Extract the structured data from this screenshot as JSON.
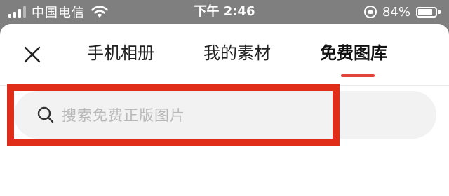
{
  "status_bar": {
    "carrier": "中国电信",
    "time": "下午 2:46",
    "battery_percent": "84%",
    "battery_level": 0.84,
    "icons": [
      "signal-icon",
      "wifi-icon",
      "rotation-lock-icon",
      "battery-icon"
    ]
  },
  "nav": {
    "close_icon": "close-icon",
    "tabs": [
      {
        "label": "手机相册",
        "active": false
      },
      {
        "label": "我的素材",
        "active": false
      },
      {
        "label": "免费图库",
        "active": true
      }
    ]
  },
  "search": {
    "placeholder": "搜索免费正版图片",
    "icon": "search-icon"
  },
  "colors": {
    "accent": "#e0433c",
    "highlight_box": "#e02d1a",
    "status_bar_bg": "#7f7f7f",
    "search_bg": "#f2f2f2"
  }
}
